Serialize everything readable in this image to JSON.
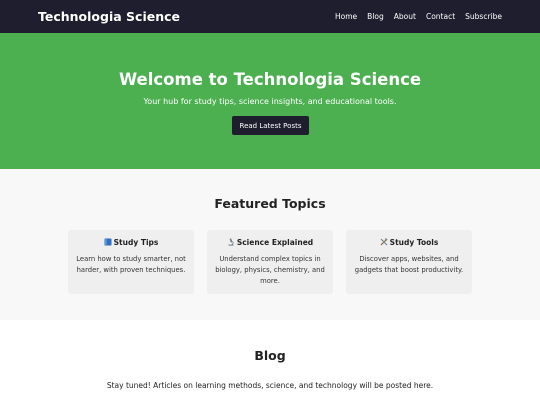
{
  "nav": {
    "brand": "Technologia Science",
    "links": [
      "Home",
      "Blog",
      "About",
      "Contact",
      "Subscribe"
    ]
  },
  "hero": {
    "title": "Welcome to Technologia Science",
    "subtitle": "Your hub for study tips, science insights, and educational tools.",
    "button_label": "Read Latest Posts"
  },
  "featured": {
    "title": "Featured Topics",
    "cards": [
      {
        "icon": "book-icon",
        "title": "Study Tips",
        "text": "Learn how to study smarter, not harder, with proven techniques."
      },
      {
        "icon": "microscope-icon",
        "title": "Science Explained",
        "text": "Understand complex topics in biology, physics, chemistry, and more."
      },
      {
        "icon": "tools-icon",
        "title": "Study Tools",
        "text": "Discover apps, websites, and gadgets that boost productivity."
      }
    ]
  },
  "blog": {
    "title": "Blog",
    "text": "Stay tuned! Articles on learning methods, science, and technology will be posted here."
  },
  "colors": {
    "nav_bg": "#1e1e2e",
    "hero_bg": "#4caf50",
    "section_bg": "#f8f8f8",
    "card_bg": "#efefef"
  }
}
